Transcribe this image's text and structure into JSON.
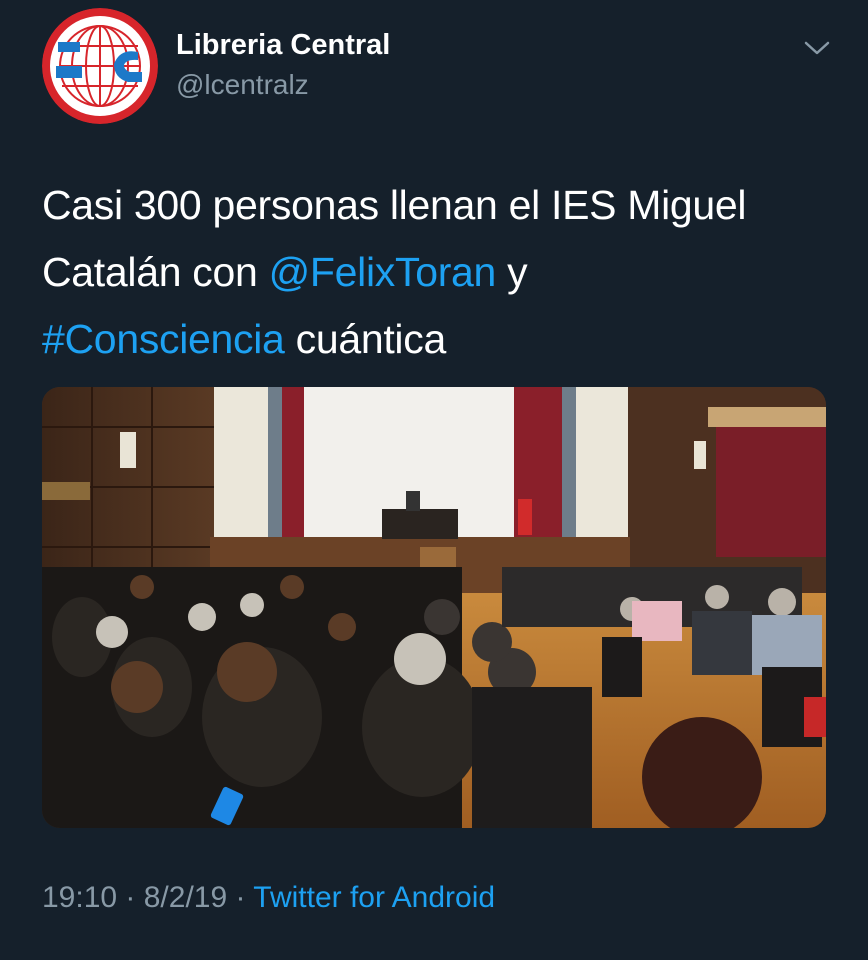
{
  "author": {
    "display_name": "Libreria Central",
    "handle": "@lcentralz",
    "avatar_icon": "libreria-central-logo-icon"
  },
  "menu": {
    "icon": "chevron-down-icon"
  },
  "tweet": {
    "text_part1": "Casi 300 personas llenan el IES Miguel Catalán con ",
    "mention": "@FelixToran",
    "text_part2": " y ",
    "hashtag": "#Consciencia",
    "text_part3": " cuántica"
  },
  "photo": {
    "subject": "auditorium-audience-photo"
  },
  "meta": {
    "time": "19:10",
    "separator1": " · ",
    "date": "8/2/19",
    "separator2": " · ",
    "source": "Twitter for Android"
  },
  "colors": {
    "background": "#15202b",
    "link": "#1da1f2",
    "secondary_text": "#8899a6"
  }
}
